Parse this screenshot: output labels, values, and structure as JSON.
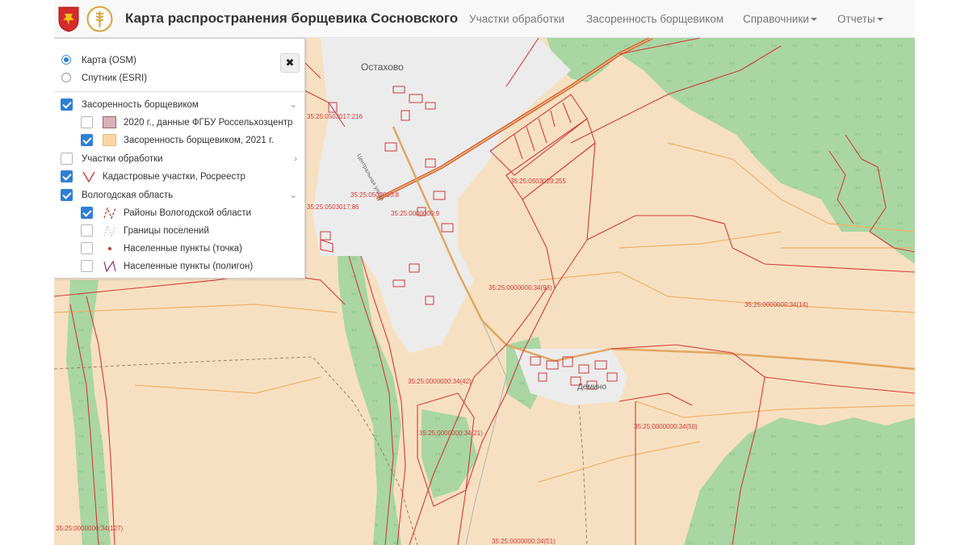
{
  "app": {
    "title": "Карта распространения борщевика Сосновского",
    "nav": {
      "plots": "Участки обработки",
      "infestation": "Засоренность борщевиком",
      "references": "Справочники",
      "reports": "Отчеты"
    }
  },
  "layers_panel": {
    "close_label": "✖",
    "basemaps": [
      {
        "label": "Карта (OSM)",
        "selected": true
      },
      {
        "label": "Спутник (ESRI)",
        "selected": false
      }
    ],
    "groups": {
      "infestation": {
        "label": "Засоренность борщевиком",
        "checked": true,
        "expanded": true,
        "items": [
          {
            "label": "2020 г., данные ФГБУ Россельхозцентр",
            "checked": false,
            "swatch_fill": "#d8b2b6",
            "swatch_border": "#a06070"
          },
          {
            "label": "Засоренность борщевиком, 2021 г.",
            "checked": true,
            "swatch_fill": "#f9d7a3",
            "swatch_border": "#e6b97a"
          }
        ]
      },
      "plots": {
        "label": "Участки обработки",
        "checked": false,
        "expanded": false
      },
      "cadastral": {
        "label": "Кадастровые участки, Росреестр",
        "checked": true
      },
      "region": {
        "label": "Вологодская область",
        "checked": true,
        "expanded": true,
        "items": [
          {
            "label": "Районы Вологодской области",
            "checked": true
          },
          {
            "label": "Границы поселений",
            "checked": false
          },
          {
            "label": "Населенные пункты (точка)",
            "checked": false
          },
          {
            "label": "Населенные пункты (полигон)",
            "checked": false
          }
        ]
      }
    }
  },
  "map": {
    "places": [
      "Остахово",
      "Демино"
    ],
    "street": "Центральная улица",
    "parcel_labels": [
      "35:25:0503029:255",
      "35:25:0000000:34(98)",
      "35:25:0000000:34(14)",
      "35:25:0000000:34(42)",
      "35:25:0000000:34(21)",
      "35:25:0000000:34(50)",
      "35:25:0000000:34(51)",
      "35:25:0000000:34(127)",
      "35:25:0503010:8",
      "35:25:0000000:9",
      "35:25:0503017:86",
      "35:25:0503017:216"
    ],
    "colors": {
      "field": "#f7e0c1",
      "forest": "#a8d5a2",
      "boundary": "#d33a3a",
      "road": "#e8a850",
      "settlement": "#ececec"
    }
  }
}
